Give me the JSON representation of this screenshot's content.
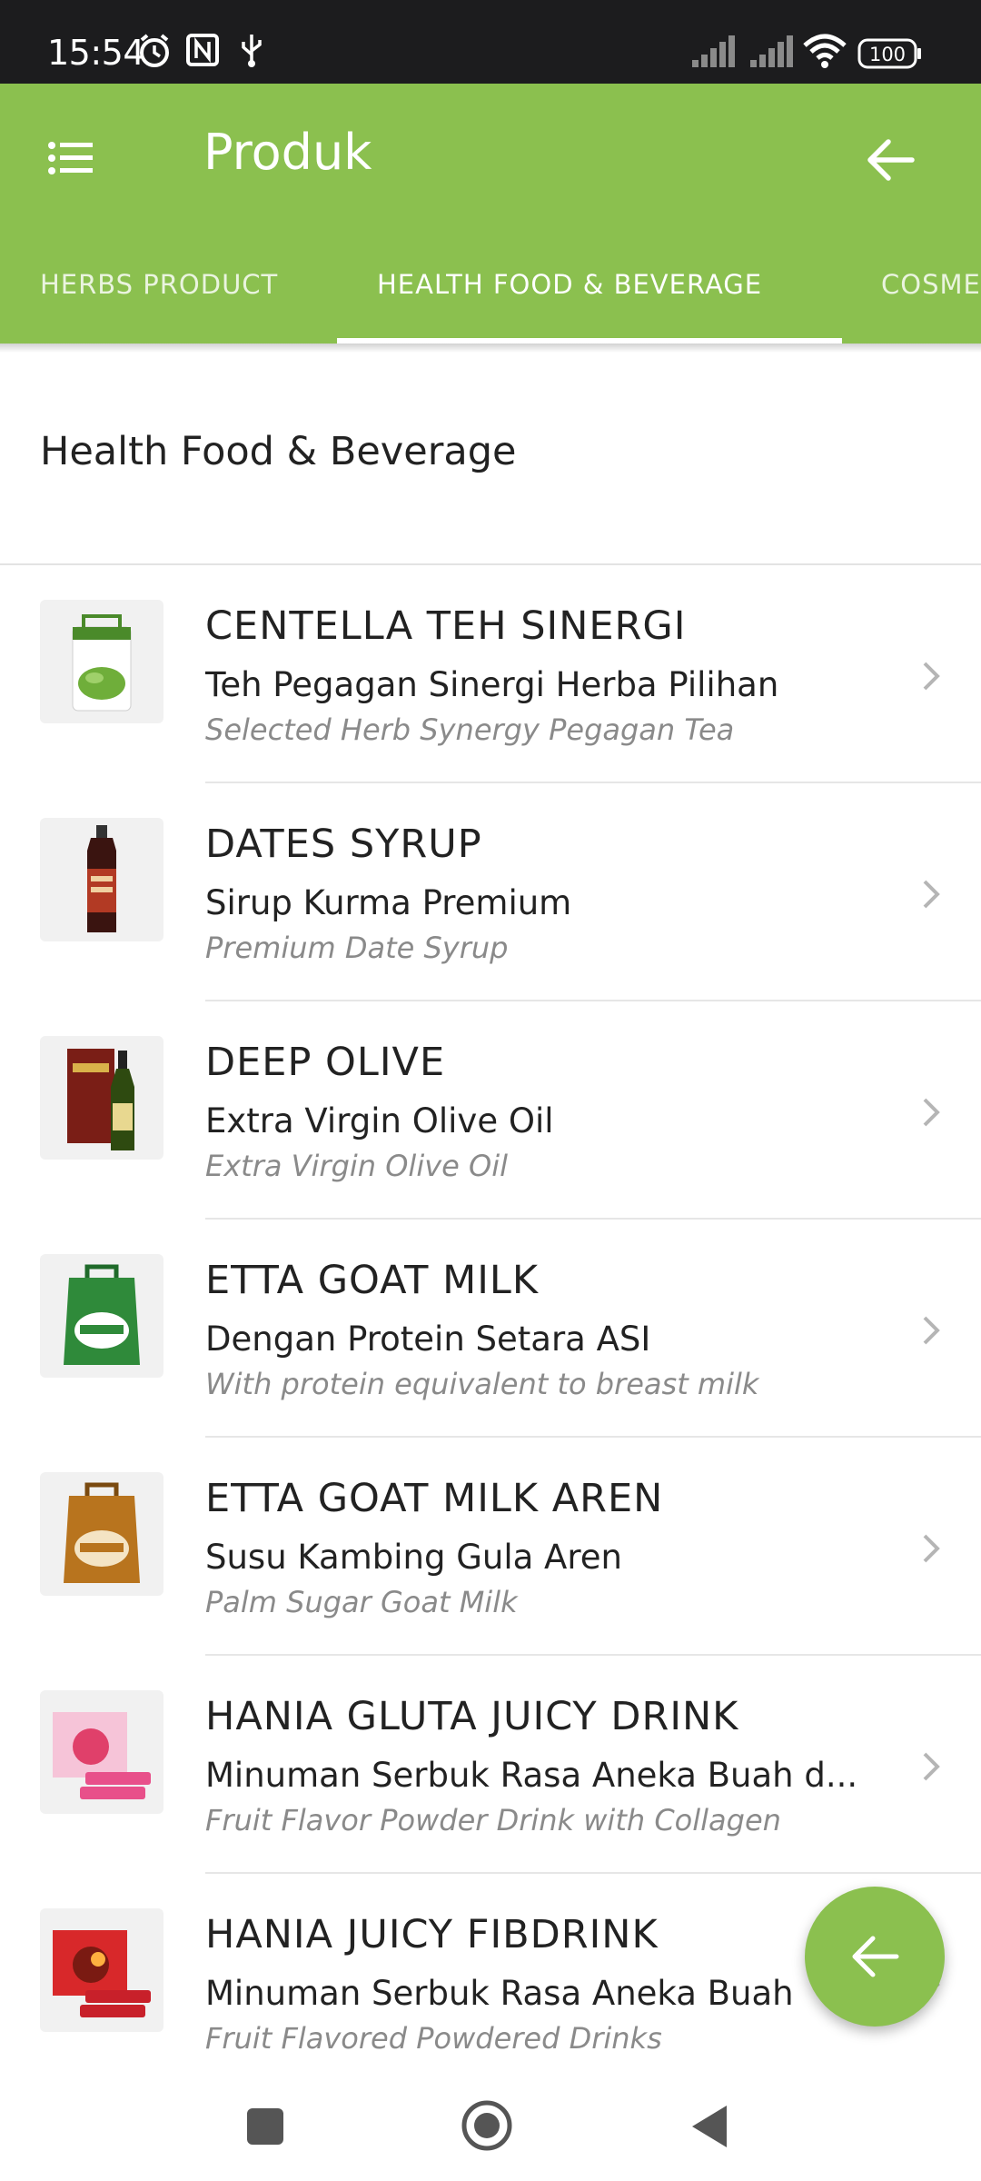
{
  "status_bar": {
    "time": "15:54",
    "battery": "100",
    "icons": [
      "alarm-icon",
      "nfc-icon",
      "usb-icon",
      "signal-icon",
      "signal-icon",
      "wifi-icon",
      "battery-icon"
    ]
  },
  "app_bar": {
    "title": "Produk",
    "menu_icon": "menu-icon",
    "back_icon": "back-arrow-icon",
    "color": "#8bc04f"
  },
  "tabs": [
    {
      "label": "HERBS PRODUCT",
      "selected": false
    },
    {
      "label": "HEALTH FOOD & BEVERAGE",
      "selected": true
    },
    {
      "label": "COSME",
      "selected": false
    }
  ],
  "section": {
    "title": "Health Food & Beverage"
  },
  "products": [
    {
      "name": "CENTELLA TEH SINERGI",
      "subtitle": "Teh Pegagan Sinergi Herba Pilihan",
      "english": "Selected Herb Synergy Pegagan Tea"
    },
    {
      "name": "DATES SYRUP",
      "subtitle": "Sirup Kurma Premium",
      "english": "Premium Date Syrup"
    },
    {
      "name": "DEEP OLIVE",
      "subtitle": "Extra Virgin Olive Oil",
      "english": "Extra Virgin Olive Oil"
    },
    {
      "name": "ETTA GOAT MILK",
      "subtitle": "Dengan Protein Setara ASI",
      "english": "With protein equivalent to breast milk"
    },
    {
      "name": "ETTA GOAT MILK AREN",
      "subtitle": "Susu Kambing Gula Aren",
      "english": "Palm Sugar Goat Milk"
    },
    {
      "name": "HANIA GLUTA JUICY DRINK",
      "subtitle": "Minuman Serbuk Rasa Aneka Buah d...",
      "english": "Fruit Flavor Powder Drink with Collagen"
    },
    {
      "name": "HANIA JUICY FIBDRINK",
      "subtitle": "Minuman Serbuk Rasa Aneka Buah",
      "english": "Fruit Flavored Powdered Drinks"
    }
  ],
  "fab": {
    "icon": "back-arrow-icon"
  },
  "nav_bar": {
    "icons": [
      "recent-apps-icon",
      "home-icon",
      "back-icon"
    ]
  }
}
